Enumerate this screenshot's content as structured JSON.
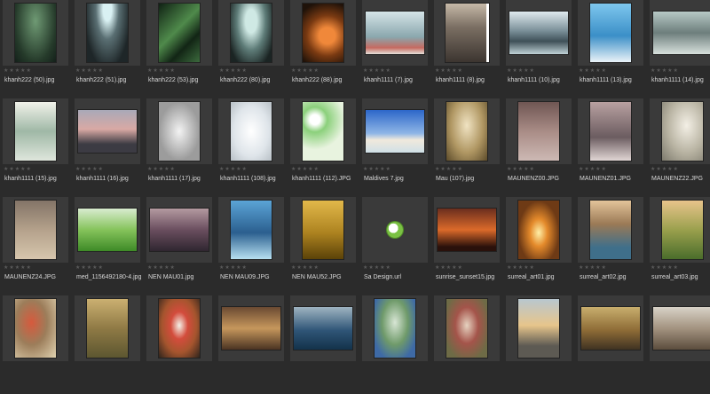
{
  "stars": "★★★★★",
  "items": [
    {
      "name": "khanh222 (50).jpg",
      "thumb": "portrait",
      "style": "g1"
    },
    {
      "name": "khanh222 (51).jpg",
      "thumb": "portrait",
      "style": "g2"
    },
    {
      "name": "khanh222 (53).jpg",
      "thumb": "portrait",
      "style": "g3"
    },
    {
      "name": "khanh222 (80).jpg",
      "thumb": "portrait",
      "style": "g4"
    },
    {
      "name": "khanh222 (88).jpg",
      "thumb": "portrait",
      "style": "g5"
    },
    {
      "name": "khanh1111 (7).jpg",
      "thumb": "landscape",
      "style": "g6"
    },
    {
      "name": "khanh1111 (8).jpg",
      "thumb": "portrait",
      "style": "g7"
    },
    {
      "name": "khanh1111 (10).jpg",
      "thumb": "landscape",
      "style": "g8"
    },
    {
      "name": "khanh1111 (13).jpg",
      "thumb": "portrait",
      "style": "g9"
    },
    {
      "name": "khanh1111 (14).jpg",
      "thumb": "landscape",
      "style": "g10"
    },
    {
      "name": "khanh1111 (15).jpg",
      "thumb": "portrait",
      "style": "g11"
    },
    {
      "name": "khanh1111 (16).jpg",
      "thumb": "landscape",
      "style": "g12"
    },
    {
      "name": "khanh1111 (17).jpg",
      "thumb": "portrait",
      "style": "g13"
    },
    {
      "name": "khanh1111 (108).jpg",
      "thumb": "portrait",
      "style": "g14"
    },
    {
      "name": "khanh1111 (112).JPG",
      "thumb": "portrait",
      "style": "g15"
    },
    {
      "name": "Maldives 7.jpg",
      "thumb": "landscape",
      "style": "g16"
    },
    {
      "name": "Mau (107).jpg",
      "thumb": "portrait",
      "style": "g17"
    },
    {
      "name": "MAUNENZ00.JPG",
      "thumb": "portrait",
      "style": "g18"
    },
    {
      "name": "MAUNENZ01.JPG",
      "thumb": "portrait",
      "style": "g19"
    },
    {
      "name": "MAUNENZ22.JPG",
      "thumb": "portrait",
      "style": "g20"
    },
    {
      "name": "MAUNENZ24.JPG",
      "thumb": "portrait",
      "style": "g21"
    },
    {
      "name": "med_1156492180-4.jpg",
      "thumb": "landscape",
      "style": "g22"
    },
    {
      "name": "NEN MAU01.jpg",
      "thumb": "landscape",
      "style": "g23"
    },
    {
      "name": "NEN MAU09.JPG",
      "thumb": "portrait",
      "style": "g24"
    },
    {
      "name": "NEN MAU52.JPG",
      "thumb": "portrait",
      "style": "g25"
    },
    {
      "name": "Sa Design.url",
      "thumb": "url",
      "style": ""
    },
    {
      "name": "sunrise_sunset15.jpg",
      "thumb": "landscape",
      "style": "g26"
    },
    {
      "name": "surreal_art01.jpg",
      "thumb": "portrait",
      "style": "g27"
    },
    {
      "name": "surreal_art02.jpg",
      "thumb": "portrait",
      "style": "g28"
    },
    {
      "name": "surreal_art03.jpg",
      "thumb": "portrait",
      "style": "g29"
    },
    {
      "name": "",
      "thumb": "portrait",
      "style": "g30"
    },
    {
      "name": "",
      "thumb": "portrait",
      "style": "g31"
    },
    {
      "name": "",
      "thumb": "portrait",
      "style": "g32"
    },
    {
      "name": "",
      "thumb": "landscape",
      "style": "g33"
    },
    {
      "name": "",
      "thumb": "landscape",
      "style": "g34"
    },
    {
      "name": "",
      "thumb": "portrait",
      "style": "g35"
    },
    {
      "name": "",
      "thumb": "portrait",
      "style": "g36"
    },
    {
      "name": "",
      "thumb": "portrait",
      "style": "g37"
    },
    {
      "name": "",
      "thumb": "landscape",
      "style": "g38"
    },
    {
      "name": "",
      "thumb": "landscape",
      "style": "g39"
    }
  ]
}
